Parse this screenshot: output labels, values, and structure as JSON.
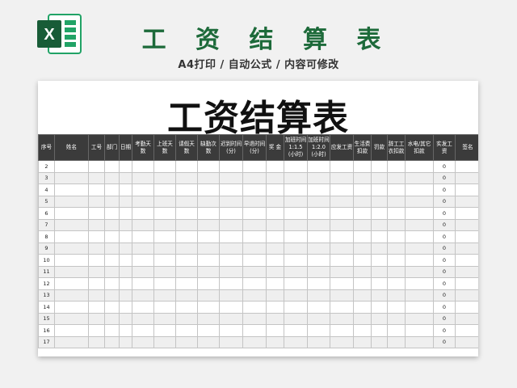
{
  "header": {
    "headline": "工 资 结 算 表",
    "subtitle": "A4打印 / 自动公式 / 内容可修改",
    "logo_letter": "X",
    "logo_colors": {
      "dark": "#185c37",
      "mid": "#21a366",
      "light": "#33c481"
    }
  },
  "sheet": {
    "title": "工资结算表",
    "columns": [
      "序号",
      "姓名",
      "工号",
      "部门",
      "日期",
      "考勤天数",
      "上班天数",
      "请假天数",
      "缺勤次数",
      "迟到时间\n(分)",
      "早退时间\n(分)",
      "奖 金",
      "加班时间\n1:1.5\n(小时)",
      "加班时间\n1:2.0\n(小时)",
      "应发工资",
      "生活费\n扣款",
      "罚款",
      "辞工工\n衣扣款",
      "水电/其它\n扣款",
      "实发工资",
      "签名"
    ],
    "rows": [
      {
        "no": "2",
        "pay": "0"
      },
      {
        "no": "3",
        "pay": "0"
      },
      {
        "no": "4",
        "pay": "0"
      },
      {
        "no": "5",
        "pay": "0"
      },
      {
        "no": "6",
        "pay": "0"
      },
      {
        "no": "7",
        "pay": "0"
      },
      {
        "no": "8",
        "pay": "0"
      },
      {
        "no": "9",
        "pay": "0"
      },
      {
        "no": "10",
        "pay": "0"
      },
      {
        "no": "11",
        "pay": "0"
      },
      {
        "no": "12",
        "pay": "0"
      },
      {
        "no": "13",
        "pay": "0"
      },
      {
        "no": "14",
        "pay": "0"
      },
      {
        "no": "15",
        "pay": "0"
      },
      {
        "no": "16",
        "pay": "0"
      },
      {
        "no": "17",
        "pay": "0"
      }
    ]
  }
}
